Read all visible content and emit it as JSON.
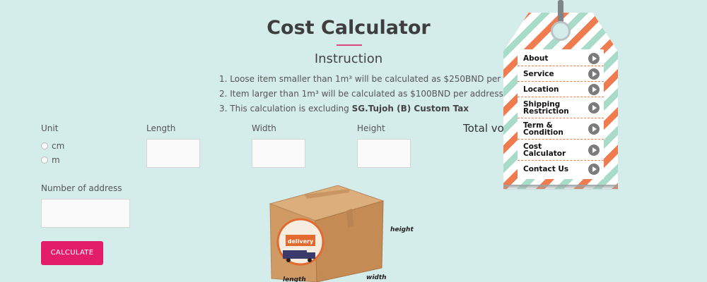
{
  "page": {
    "title": "Cost Calculator",
    "instruction_heading": "Instruction",
    "instructions": [
      {
        "prefix": "1. Loose item smaller than 1m³ will be calculated as $250BND per 1m³",
        "bold": ""
      },
      {
        "prefix": "2. Item larger than 1m³ will be calculated as $100BND per address",
        "bold": ""
      },
      {
        "prefix": "3. This calculation is excluding ",
        "bold": "SG.Tujoh (B) Custom Tax"
      }
    ]
  },
  "form": {
    "unit_label": "Unit",
    "unit_options": [
      "cm",
      "m"
    ],
    "length_label": "Length",
    "width_label": "Width",
    "height_label": "Height",
    "total_volume_label": "Total vo",
    "address_label": "Number of address",
    "calculate_label": "CALCULATE",
    "length_value": "",
    "width_value": "",
    "height_value": "",
    "address_value": ""
  },
  "illustration": {
    "height_label": "height",
    "width_label": "width",
    "length_label": "length",
    "stamp_text": "delivery"
  },
  "nav": {
    "items": [
      "About",
      "Service",
      "Location",
      "Shipping Restriction",
      "Term & Condition",
      "Cost Calculator",
      "Contact Us"
    ]
  },
  "colors": {
    "background": "#d4ecea",
    "accent": "#e41d6b",
    "tag_stripe_green": "#a8dcc8",
    "tag_stripe_orange": "#f07b4f"
  }
}
